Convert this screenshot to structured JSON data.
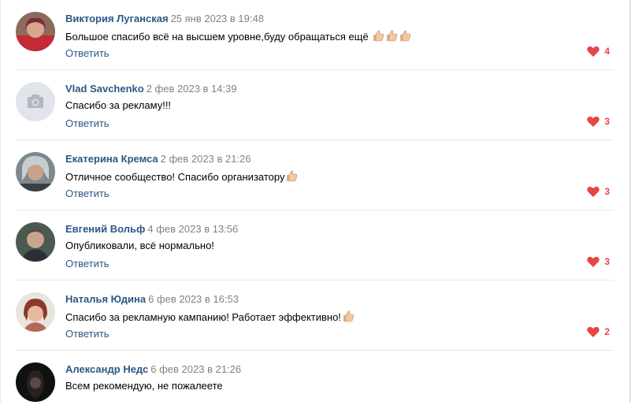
{
  "comments": [
    {
      "author": "Виктория Луганская",
      "date": "25 янв 2023 в 19:48",
      "text": "Большое спасибо всё на высшем уровне,буду обращаться ещё",
      "emoji": [
        "thumbs-up-icon",
        "thumbs-up-icon",
        "thumbs-up-icon"
      ],
      "reply_label": "Ответить",
      "likes": "4",
      "avatar": "photo"
    },
    {
      "author": "Vlad Savchenko",
      "date": "2 фев 2023 в 14:39",
      "text": "Спасибо за рекламу!!!",
      "emoji": [],
      "reply_label": "Ответить",
      "likes": "3",
      "avatar": "camera-placeholder"
    },
    {
      "author": "Екатерина Кремса",
      "date": "2 фев 2023 в 21:26",
      "text": "Отличное сообщество! Спасибо организатору",
      "emoji": [
        "thumbs-up-icon"
      ],
      "reply_label": "Ответить",
      "likes": "3",
      "avatar": "photo"
    },
    {
      "author": "Евгений Вольф",
      "date": "4 фев 2023 в 13:56",
      "text": "Опубликовали, всё нормально!",
      "emoji": [],
      "reply_label": "Ответить",
      "likes": "3",
      "avatar": "photo"
    },
    {
      "author": "Наталья Юдина",
      "date": "6 фев 2023 в 16:53",
      "text": "Спасибо за рекламную кампанию! Работает эффективно!",
      "emoji": [
        "thumbs-up-icon"
      ],
      "reply_label": "Ответить",
      "likes": "2",
      "avatar": "photo"
    },
    {
      "author": "Александр Недс",
      "date": "6 фев 2023 в 21:26",
      "text": "Всем рекомендую, не пожалеете",
      "emoji": [],
      "reply_label": "",
      "likes": "",
      "avatar": "photo"
    }
  ],
  "colors": {
    "author": "#2a5885",
    "date": "#828282",
    "like": "#e64646",
    "divider": "#e7e8ec"
  }
}
